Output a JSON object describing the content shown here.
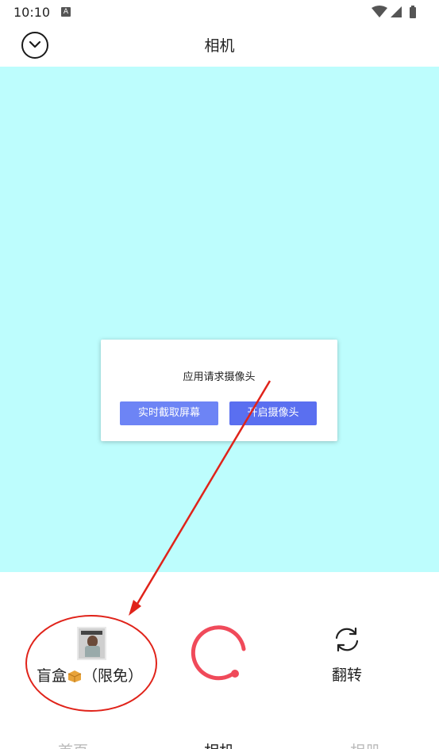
{
  "status_bar": {
    "time": "10:10",
    "notification_badge": "A",
    "icons": [
      "wifi-icon",
      "signal-icon",
      "battery-icon"
    ]
  },
  "header": {
    "title": "相机",
    "back_icon": "chevron-down-circle-icon"
  },
  "dialog": {
    "message": "应用请求摄像头",
    "screen_capture_label": "实时截取屏幕",
    "open_camera_label": "开启摄像头"
  },
  "controls": {
    "blindbox_label": "盲盒",
    "blindbox_suffix": "（限免）",
    "flip_label": "翻转",
    "shutter_icon": "shutter-ring-icon",
    "flip_icon": "camera-flip-icon"
  },
  "tabs": [
    {
      "label": "首页",
      "active": false
    },
    {
      "label": "相机",
      "active": true
    },
    {
      "label": "相册",
      "active": false
    }
  ],
  "colors": {
    "preview_bg": "#bdfdfd",
    "shutter": "#f04a5a",
    "primary_button": "#5a6ff0",
    "annotation": "#e0231a"
  }
}
